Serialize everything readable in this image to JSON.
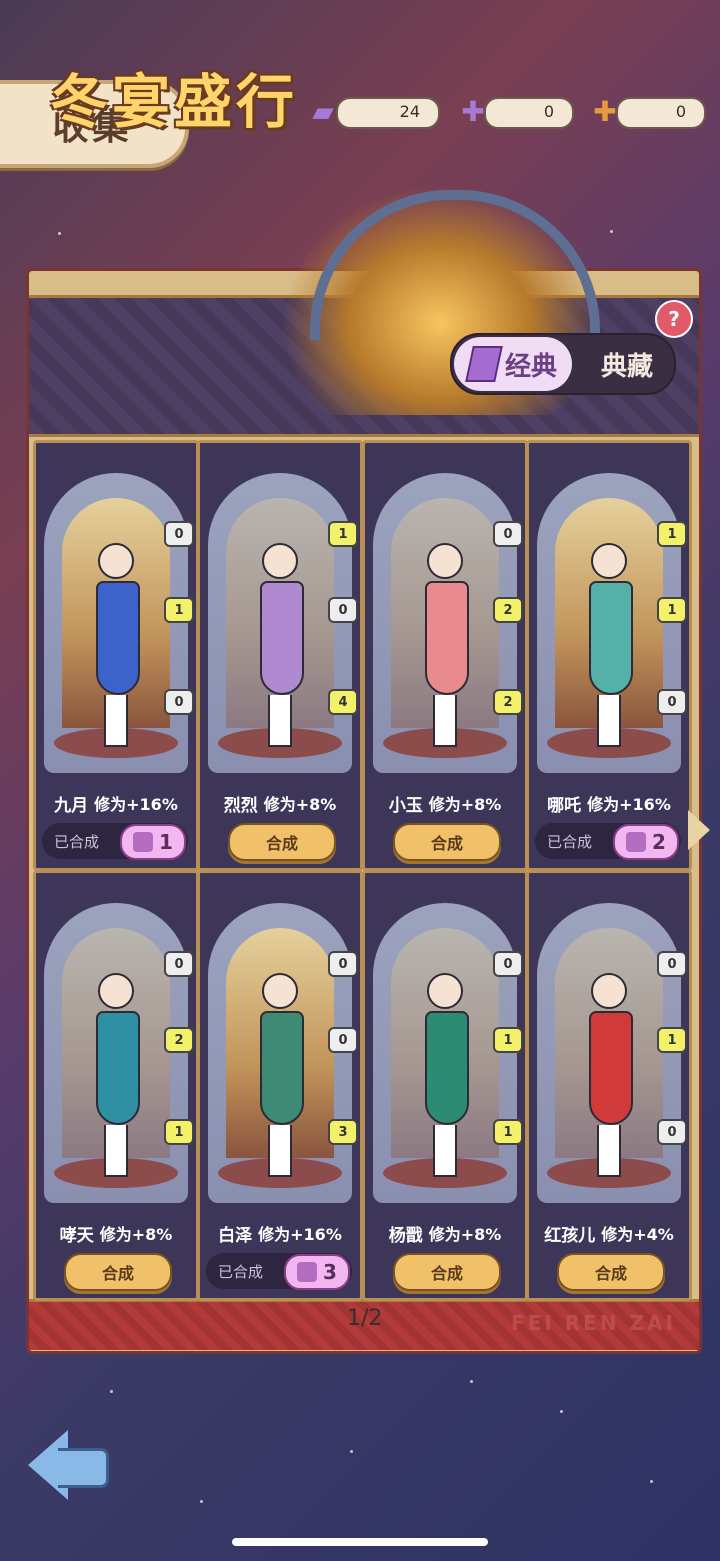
{
  "header": {
    "title": "收集",
    "resources": [
      {
        "icon": "ticket-icon",
        "value": "24"
      },
      {
        "icon": "purple-puzzle-icon",
        "value": "0"
      },
      {
        "icon": "orange-puzzle-icon",
        "value": "0"
      }
    ]
  },
  "panel": {
    "title": "冬宴盛行",
    "tabs": {
      "classic": "经典",
      "collection": "典藏"
    },
    "help": "?",
    "page": "1/2",
    "footer_mark": "FEI REN ZAI"
  },
  "labels": {
    "synthesize": "合成",
    "synthesized": "已合成"
  },
  "cards": [
    {
      "name": "九月",
      "bonus": "修为+16%",
      "counts": [
        "0",
        "1",
        "0"
      ],
      "status": "done",
      "fragments": "1",
      "outfit": "#3d62c9"
    },
    {
      "name": "烈烈",
      "bonus": "修为+8%",
      "counts": [
        "1",
        "0",
        "4"
      ],
      "status": "synth",
      "outfit": "#b08ad0"
    },
    {
      "name": "小玉",
      "bonus": "修为+8%",
      "counts": [
        "0",
        "2",
        "2"
      ],
      "status": "synth",
      "outfit": "#e88a8e"
    },
    {
      "name": "哪吒",
      "bonus": "修为+16%",
      "counts": [
        "1",
        "1",
        "0"
      ],
      "status": "done",
      "fragments": "2",
      "outfit": "#55b0a8"
    },
    {
      "name": "哮天",
      "bonus": "修为+8%",
      "counts": [
        "0",
        "2",
        "1"
      ],
      "status": "synth",
      "outfit": "#2f8fa3"
    },
    {
      "name": "白泽",
      "bonus": "修为+16%",
      "counts": [
        "0",
        "0",
        "3"
      ],
      "status": "done",
      "fragments": "3",
      "outfit": "#3e8a74"
    },
    {
      "name": "杨戬",
      "bonus": "修为+8%",
      "counts": [
        "0",
        "1",
        "1"
      ],
      "status": "synth",
      "outfit": "#2c8c73"
    },
    {
      "name": "红孩儿",
      "bonus": "修为+4%",
      "counts": [
        "0",
        "1",
        "0"
      ],
      "status": "synth",
      "outfit": "#d03a3a"
    }
  ]
}
